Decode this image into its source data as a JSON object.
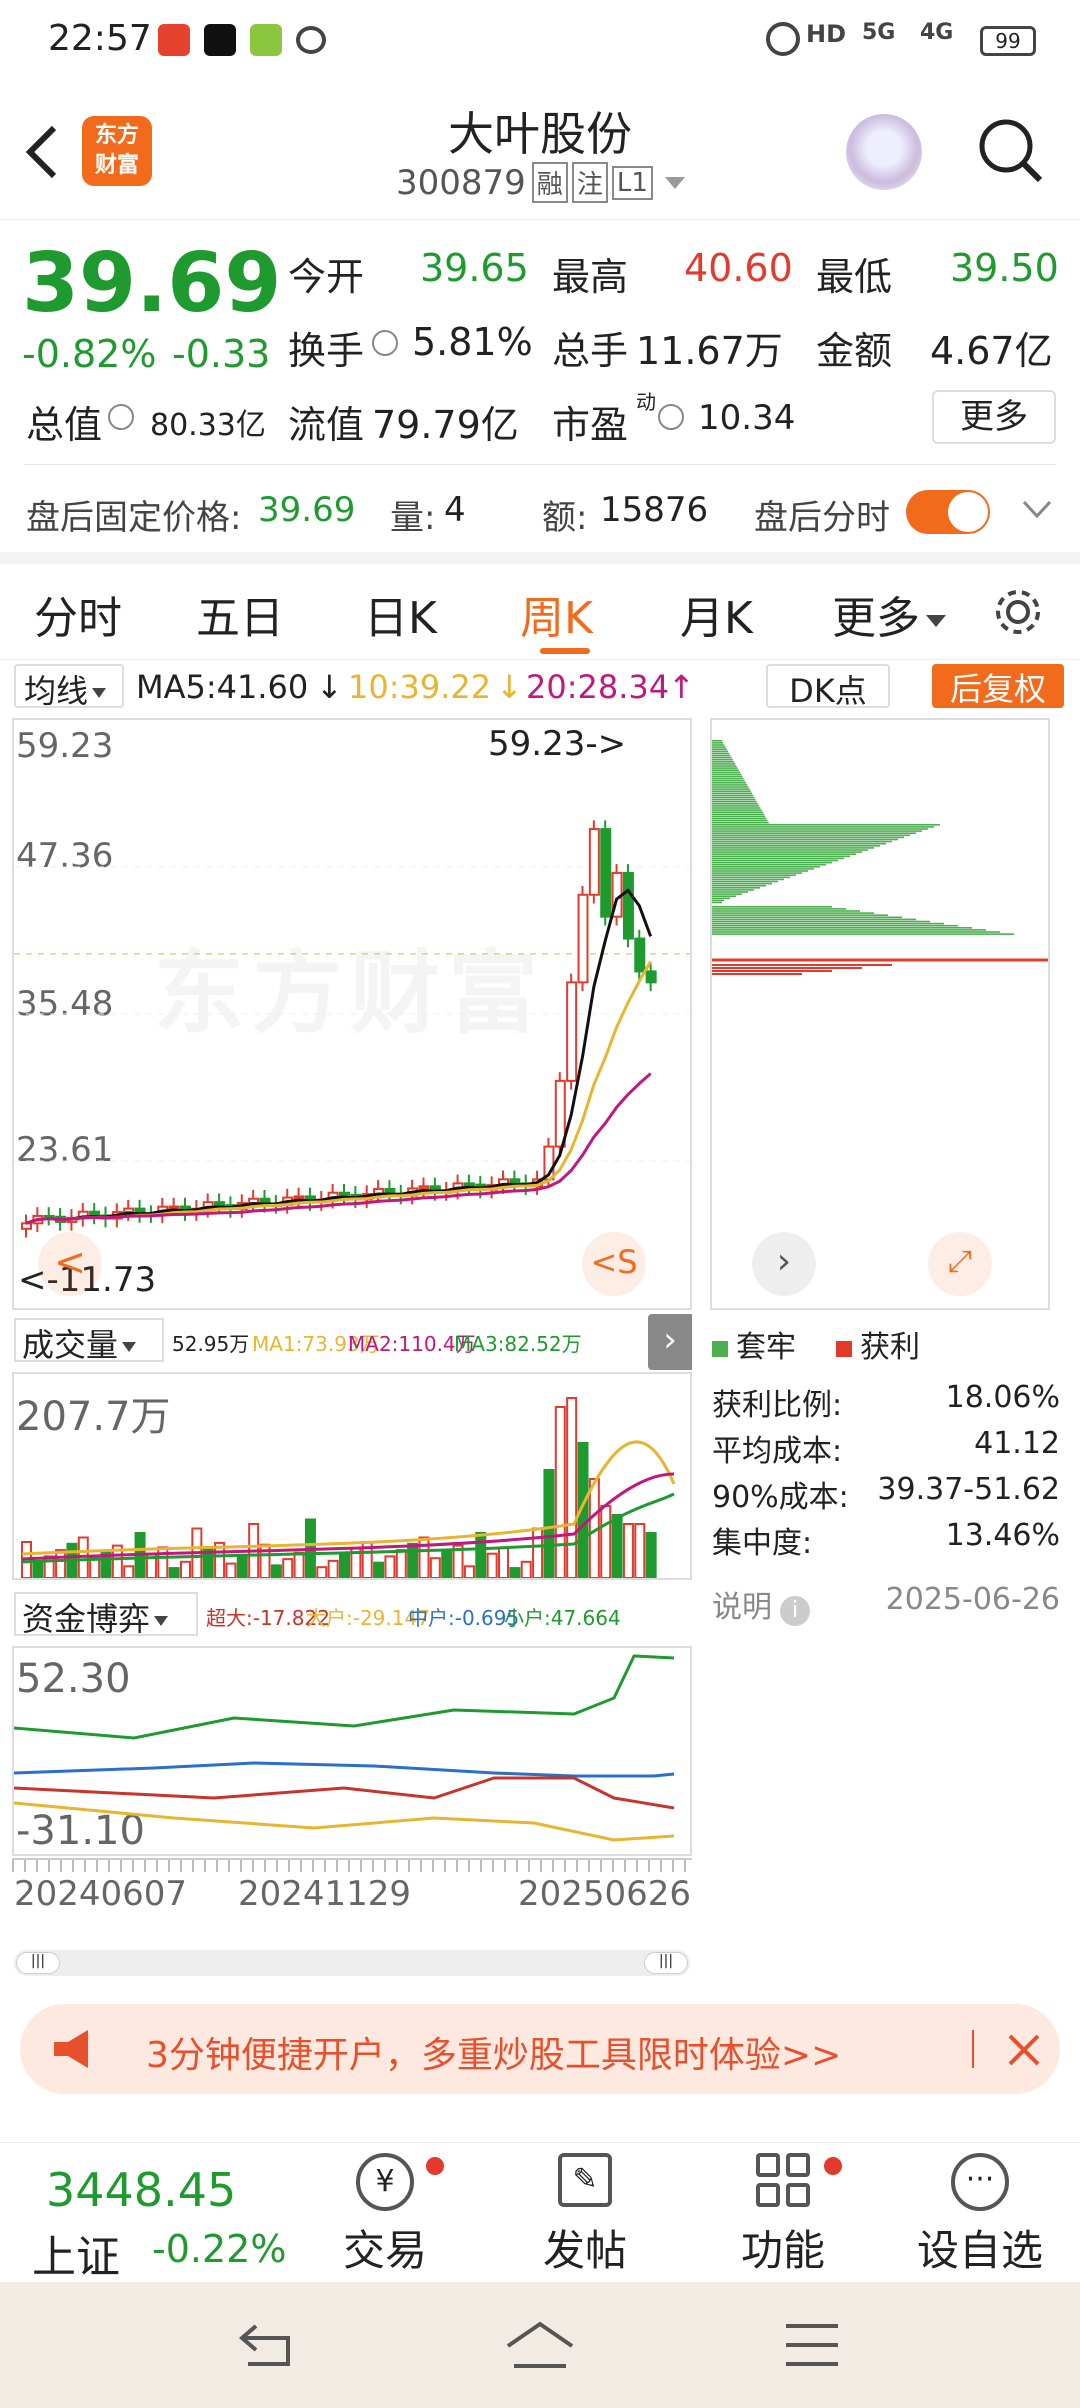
{
  "status": {
    "time": "22:57",
    "net1": "5G",
    "net2": "4G",
    "battery": "99",
    "hd": "HD"
  },
  "header": {
    "title": "大叶股份",
    "code": "300879",
    "badges": [
      "融",
      "注",
      "L1"
    ]
  },
  "quote": {
    "price": "39.69",
    "change_pct": "-0.82%",
    "change": "-0.33",
    "open_label": "今开",
    "open": "39.65",
    "high_label": "最高",
    "high": "40.60",
    "low_label": "最低",
    "low": "39.50",
    "turnover_label": "换手",
    "turnover": "5.81%",
    "volume_label": "总手",
    "volume": "11.67万",
    "amount_label": "金额",
    "amount": "4.67亿",
    "mktcap_label": "总值",
    "mktcap": "80.33亿",
    "float_label": "流值",
    "float": "79.79亿",
    "pe_label": "市盈",
    "pe_sup": "动",
    "pe": "10.34",
    "more": "更多"
  },
  "after": {
    "price_label": "盘后固定价格:",
    "price": "39.69",
    "qty_label": "量:",
    "qty": "4",
    "amt_label": "额:",
    "amt": "15876",
    "toggle_label": "盘后分时",
    "toggle_on": true
  },
  "tabs": [
    "分时",
    "五日",
    "日K",
    "周K",
    "月K",
    "更多"
  ],
  "tabs_active": 3,
  "ma": {
    "label": "均线",
    "ma5": "MA5:41.60",
    "ma10": "10:39.22",
    "ma20": "20:28.34",
    "dk": "DK点",
    "fq": "后复权"
  },
  "price_axis": {
    "y1": "59.23",
    "y2": "47.36",
    "y3": "35.48",
    "y4": "23.61",
    "low_mark": "11.73",
    "high_mark": "59.23->"
  },
  "watermark": "东方财富",
  "vol": {
    "label": "成交量",
    "v": "52.95万",
    "ma1": "MA1:73.93万",
    "ma2": "MA2:110.4万",
    "ma3": "MA3:82.52万",
    "axis": "207.7万"
  },
  "fund": {
    "label": "资金博弈",
    "super": "超大:-17.822",
    "big": "大户:-29.147",
    "mid": "中户:-0.695",
    "small": "小户:47.664",
    "top": "52.30",
    "bottom": "-31.10"
  },
  "dates": [
    "20240607",
    "20241129",
    "20250626"
  ],
  "chip": {
    "legend_trap": "套牢",
    "legend_profit": "获利",
    "rows": [
      [
        "获利比例:",
        "18.06%"
      ],
      [
        "平均成本:",
        "41.12"
      ],
      [
        "90%成本:",
        "39.37-51.62"
      ],
      [
        "集中度:",
        "13.46%"
      ]
    ],
    "note": "说明",
    "date": "2025-06-26"
  },
  "banner": "3分钟便捷开户，多重炒股工具限时体验>>",
  "bottom": {
    "index_val": "3448.45",
    "index_name": "上证",
    "index_chg": "-0.22%",
    "items": [
      "交易",
      "发帖",
      "功能",
      "设自选"
    ]
  },
  "colors": {
    "accent": "#f26b1d",
    "up": "#e23b2e",
    "down": "#1f9a2e"
  }
}
